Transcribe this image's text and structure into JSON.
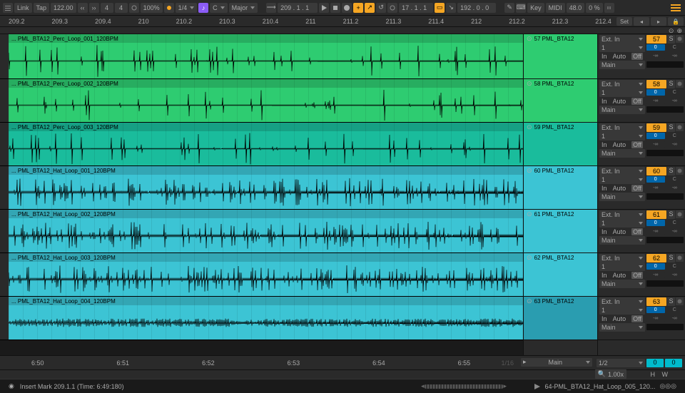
{
  "toolbar": {
    "link": "Link",
    "tap": "Tap",
    "tempo": "122.00",
    "sig1": "4",
    "sig2": "4",
    "metro_pct": "100%",
    "quant": "1/4",
    "key_root": "C",
    "key_scale": "Major",
    "position": "209 . 1 . 1",
    "loop_pos": "17 . 1 . 1",
    "loop_len": "192 . 0 . 0",
    "key_label": "Key",
    "midi_label": "MIDI",
    "midi_pct": "48.0",
    "cpu": "0 %"
  },
  "ruler": {
    "marks": [
      "209.2",
      "209.3",
      "209.4",
      "210",
      "210.2",
      "210.3",
      "210.4",
      "211",
      "211.2",
      "211.3",
      "211.4",
      "212",
      "212.2",
      "212.3",
      "212.4"
    ],
    "set": "Set",
    "grid": "1/16"
  },
  "tracks": [
    {
      "clip_name": "... PML_BTA12_Perc_Loop_001_120BPM",
      "color": "clip-green",
      "mixer_color": "#2ecc71",
      "mixer_label": "57 PML_BTA12",
      "io_num": "57",
      "seed": 1
    },
    {
      "clip_name": "... PML_BTA12_Perc_Loop_002_120BPM",
      "color": "clip-green",
      "mixer_color": "#2ecc71",
      "mixer_label": "58 PML_BTA12",
      "io_num": "58",
      "seed": 2
    },
    {
      "clip_name": "... PML_BTA12_Perc_Loop_003_120BPM",
      "color": "clip-teal",
      "mixer_color": "#1abc9c",
      "mixer_label": "59 PML_BTA12",
      "io_num": "59",
      "seed": 3
    },
    {
      "clip_name": "... PML_BTA12_Hat_Loop_001_120BPM",
      "color": "clip-cyan",
      "mixer_color": "#3cc4d4",
      "mixer_label": "60 PML_BTA12",
      "io_num": "60",
      "seed": 4
    },
    {
      "clip_name": "... PML_BTA12_Hat_Loop_002_120BPM",
      "color": "clip-cyan",
      "mixer_color": "#3cc4d4",
      "mixer_label": "61 PML_BTA12",
      "io_num": "61",
      "seed": 5
    },
    {
      "clip_name": "... PML_BTA12_Hat_Loop_003_120BPM",
      "color": "clip-cyan",
      "mixer_color": "#3cc4d4",
      "mixer_label": "62 PML_BTA12",
      "io_num": "62",
      "seed": 6
    },
    {
      "clip_name": "... PML_BTA12_Hat_Loop_004_120BPM",
      "color": "clip-cyan",
      "mixer_color": "#2a9db0",
      "mixer_label": "63 PML_BTA12",
      "io_num": "63",
      "seed": 7
    }
  ],
  "io_common": {
    "ext_in": "Ext. In",
    "one": "1",
    "in": "In",
    "auto": "Auto",
    "off": "Off",
    "main": "Main",
    "neg_inf": "-∞",
    "c": "C",
    "s": "S",
    "zero": "0"
  },
  "master": {
    "label": "Main",
    "half": "1/2",
    "zoom": "1.00x",
    "h": "H",
    "w": "W",
    "io_val": "0"
  },
  "status": {
    "text": "Insert Mark 209.1.1 (Time: 6:49:180)",
    "playing": "64-PML_BTA12_Hat_Loop_005_120..."
  },
  "time_ruler": [
    "6:50",
    "6:51",
    "6:52",
    "6:53",
    "6:54",
    "6:55"
  ]
}
